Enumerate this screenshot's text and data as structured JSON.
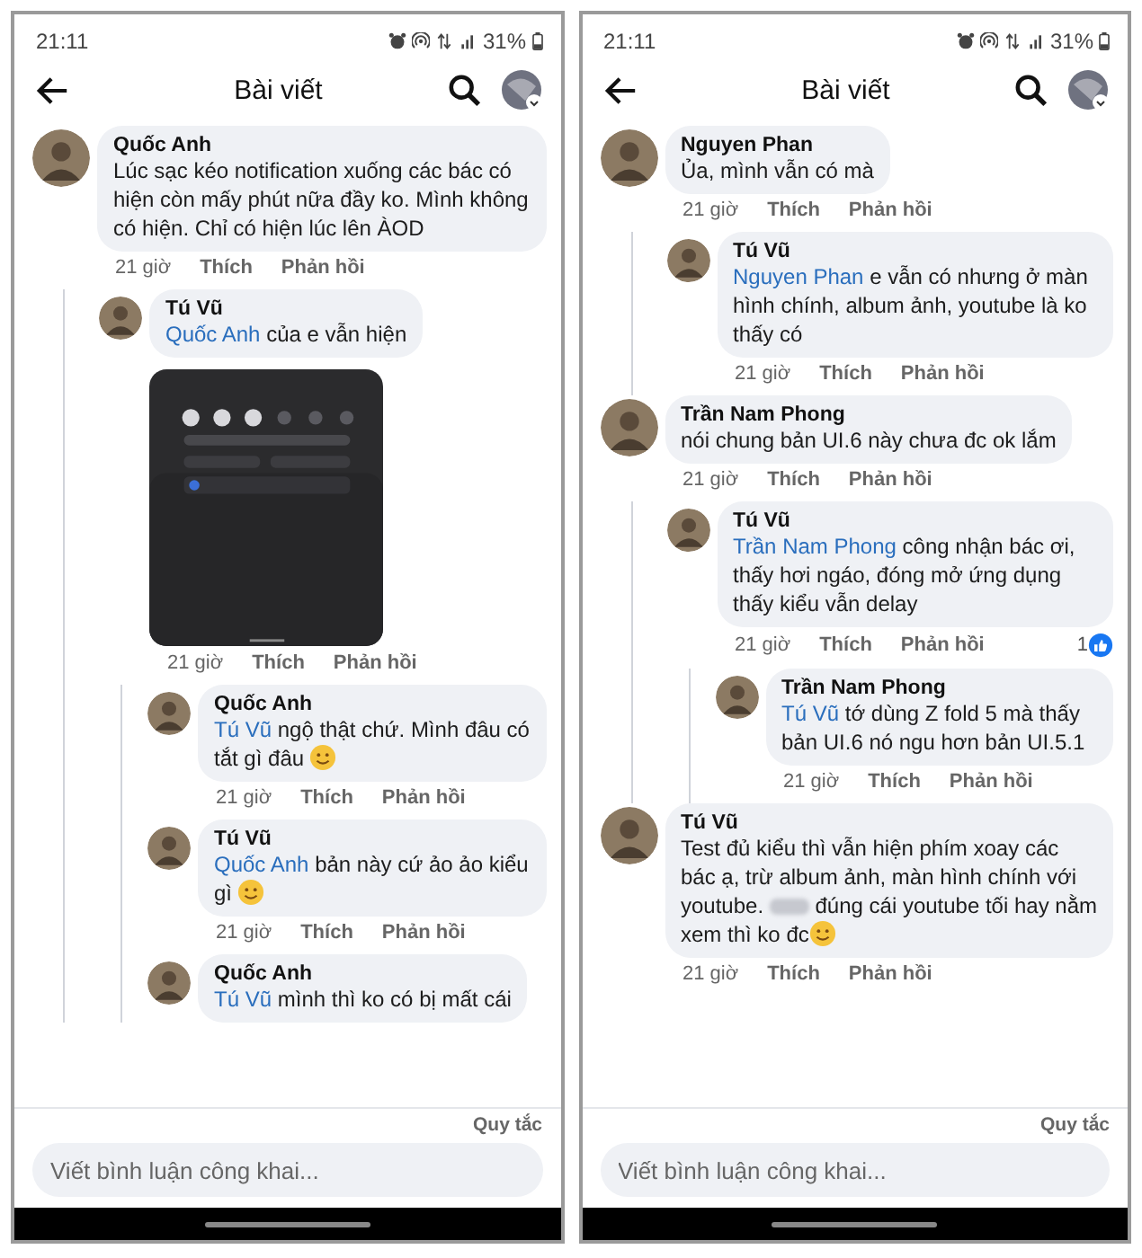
{
  "phones": [
    {
      "status_bar": {
        "time": "21:11",
        "battery": "31%"
      },
      "header": {
        "title": "Bài viết"
      },
      "comments": [
        {
          "author": "Quốc Anh",
          "text": "Lúc sạc kéo notification xuống các bác có hiện còn mấy phút nữa đầy ko. Mình không có hiện. Chỉ có hiện lúc lên ÀOD",
          "time": "21 giờ",
          "like": "Thích",
          "reply": "Phản hồi",
          "children": [
            {
              "author": "Tú Vũ",
              "mention": "Quốc Anh",
              "text": "của e vẫn hiện",
              "time": "21 giờ",
              "like": "Thích",
              "reply": "Phản hồi",
              "children": [
                {
                  "author": "Quốc Anh",
                  "mention": "Tú Vũ",
                  "text": "ngộ thật chứ. Mình đâu có tắt gì đâu",
                  "emoji": true,
                  "time": "21 giờ",
                  "like": "Thích",
                  "reply": "Phản hồi"
                },
                {
                  "author": "Tú Vũ",
                  "mention": "Quốc Anh",
                  "text": "bản này cứ ảo ảo kiểu gì",
                  "emoji": true,
                  "time": "21 giờ",
                  "like": "Thích",
                  "reply": "Phản hồi"
                },
                {
                  "author": "Quốc Anh",
                  "mention": "Tú Vũ",
                  "text": "mình thì ko có bị mất cái"
                }
              ]
            }
          ]
        }
      ],
      "footer": {
        "rules_link": "Quy tắc",
        "comment_field": {
          "placeholder": "Viết bình luận công khai..."
        }
      }
    },
    {
      "status_bar": {
        "time": "21:11",
        "battery": "31%"
      },
      "header": {
        "title": "Bài viết"
      },
      "comments": [
        {
          "author": "Nguyen Phan",
          "text": "Ủa, mình vẫn có mà",
          "time": "21 giờ",
          "like": "Thích",
          "reply": "Phản hồi",
          "children": [
            {
              "author": "Tú Vũ",
              "mention": "Nguyen Phan",
              "text": "e vẫn có nhưng ở màn hình chính, album ảnh, youtube là ko thấy có",
              "time": "21 giờ",
              "like": "Thích",
              "reply": "Phản hồi"
            }
          ]
        },
        {
          "author": "Trần Nam Phong",
          "text": "nói chung bản UI.6 này chưa đc ok lắm",
          "time": "21 giờ",
          "like": "Thích",
          "reply": "Phản hồi",
          "children": [
            {
              "author": "Tú Vũ",
              "mention": "Trần Nam Phong",
              "text": "công nhận bác ơi, thấy hơi ngáo, đóng mở ứng dụng thấy kiểu vẫn delay",
              "time": "21 giờ",
              "like": "Thích",
              "reply": "Phản hồi",
              "reactions": "1",
              "children": [
                {
                  "author": "Trần Nam Phong",
                  "mention": "Tú Vũ",
                  "text": "tớ dùng Z fold 5 mà thấy bản UI.6 nó ngu hơn bản UI.5.1",
                  "time": "21 giờ",
                  "like": "Thích",
                  "reply": "Phản hồi"
                }
              ]
            }
          ]
        },
        {
          "author": "Tú Vũ",
          "text": "Test đủ kiểu thì vẫn hiện phím xoay các bác ạ, trừ album ảnh, màn hình chính với youtube.",
          "blurred_word": true,
          "text_after": "đúng cái youtube tối hay nằm xem thì ko đc",
          "emoji": true,
          "time": "21 giờ",
          "like": "Thích",
          "reply": "Phản hồi"
        }
      ],
      "footer": {
        "rules_link": "Quy tắc",
        "comment_field": {
          "placeholder": "Viết bình luận công khai..."
        }
      }
    }
  ]
}
